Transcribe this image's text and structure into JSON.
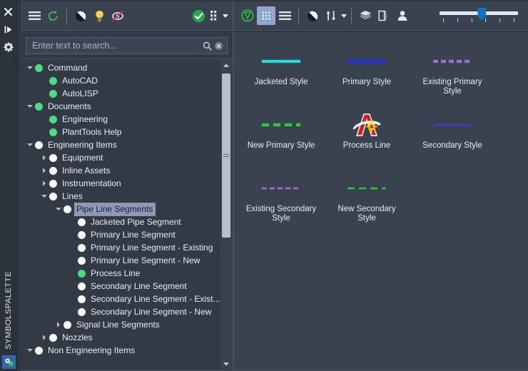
{
  "window": {
    "title": "SYMBOLSPALETTE",
    "rail_icons": [
      "close-icon",
      "dock-pin-icon",
      "settings-gear-icon"
    ],
    "rail_bottom_icon": "plant-tools-icon"
  },
  "left_toolbar": {
    "buttons": [
      {
        "name": "menu-button",
        "icon": "hamburger-menu-icon",
        "active": false
      },
      {
        "name": "refresh-button",
        "icon": "refresh-circular-arrows-icon",
        "active": false
      },
      {
        "name": "contrast-button",
        "icon": "contrast-half-circle-icon",
        "active": false
      },
      {
        "name": "hint-button",
        "icon": "lightbulb-icon",
        "active": false
      },
      {
        "name": "hide-preview-button",
        "icon": "no-preview-crossed-icon",
        "active": false
      },
      {
        "name": "validate-button",
        "icon": "green-check-circle-icon",
        "active": false
      },
      {
        "name": "grid-options-button",
        "icon": "grid-dots-icon",
        "active": false
      }
    ]
  },
  "right_toolbar": {
    "buttons": [
      {
        "name": "shape-filter-button",
        "icon": "green-outline-shape-icon",
        "active": false
      },
      {
        "name": "grid-view-button",
        "icon": "grid-view-icon",
        "active": true
      },
      {
        "name": "list-view-button",
        "icon": "list-view-icon",
        "active": false
      },
      {
        "name": "contrast-button",
        "icon": "contrast-half-circle-icon",
        "active": false
      },
      {
        "name": "sort-button",
        "icon": "sort-arrows-icon",
        "active": false
      },
      {
        "name": "layers-button",
        "icon": "layers-stack-icon",
        "active": false
      },
      {
        "name": "annotation-button",
        "icon": "abc-text-icon",
        "active": false
      },
      {
        "name": "user-button",
        "icon": "person-icon",
        "active": false
      }
    ],
    "zoom_slider": {
      "name": "zoom-slider",
      "tick_count": 6,
      "value_percent": 54
    }
  },
  "search": {
    "placeholder": "Enter text to search...",
    "value": "",
    "search_icon": "magnifier-icon",
    "clear_icon": "clear-circle-x-icon"
  },
  "tree": {
    "items": [
      {
        "label": "Command",
        "indent": 0,
        "twist": "down",
        "dot": "green"
      },
      {
        "label": "AutoCAD",
        "indent": 1,
        "twist": "none",
        "dot": "green"
      },
      {
        "label": "AutoLISP",
        "indent": 1,
        "twist": "none",
        "dot": "green"
      },
      {
        "label": "Documents",
        "indent": 0,
        "twist": "down",
        "dot": "green"
      },
      {
        "label": "Engineering",
        "indent": 1,
        "twist": "none",
        "dot": "green"
      },
      {
        "label": "PlantTools Help",
        "indent": 1,
        "twist": "none",
        "dot": "green"
      },
      {
        "label": "Engineering Items",
        "indent": 0,
        "twist": "down",
        "dot": "white"
      },
      {
        "label": "Equipment",
        "indent": 1,
        "twist": "right",
        "dot": "white"
      },
      {
        "label": "Inline Assets",
        "indent": 1,
        "twist": "right",
        "dot": "white"
      },
      {
        "label": "Instrumentation",
        "indent": 1,
        "twist": "right",
        "dot": "white"
      },
      {
        "label": "Lines",
        "indent": 1,
        "twist": "down",
        "dot": "white"
      },
      {
        "label": "Pipe Line Segments",
        "indent": 2,
        "twist": "down",
        "dot": "white",
        "selected": true
      },
      {
        "label": "Jacketed Pipe Segment",
        "indent": 3,
        "twist": "none",
        "dot": "white"
      },
      {
        "label": "Primary Line Segment",
        "indent": 3,
        "twist": "none",
        "dot": "white"
      },
      {
        "label": "Primary Line Segment - Existing",
        "indent": 3,
        "twist": "none",
        "dot": "white"
      },
      {
        "label": "Primary Line Segment - New",
        "indent": 3,
        "twist": "none",
        "dot": "white"
      },
      {
        "label": "Process Line",
        "indent": 3,
        "twist": "none",
        "dot": "green"
      },
      {
        "label": "Secondary Line Segment",
        "indent": 3,
        "twist": "none",
        "dot": "white"
      },
      {
        "label": "Secondary Line Segment - Exist...",
        "indent": 3,
        "twist": "none",
        "dot": "white"
      },
      {
        "label": "Secondary Line Segment - New",
        "indent": 3,
        "twist": "none",
        "dot": "white"
      },
      {
        "label": "Signal Line Segments",
        "indent": 2,
        "twist": "right",
        "dot": "white"
      },
      {
        "label": "Nozzles",
        "indent": 1,
        "twist": "right",
        "dot": "white"
      },
      {
        "label": "Non Engineering Items",
        "indent": 0,
        "twist": "down",
        "dot": "white"
      }
    ],
    "scrollbar": {
      "name": "tree-vertical-scrollbar"
    }
  },
  "symbols": [
    {
      "label": "Jacketed Style",
      "art": "line",
      "color": "#1ee0d8",
      "dash": "solid"
    },
    {
      "label": "Primary Style",
      "art": "line",
      "color": "#1f30e6",
      "dash": "solid"
    },
    {
      "label": "Existing Primary Style",
      "art": "line",
      "color": "#9b6fd4",
      "dash": "dashed-short"
    },
    {
      "label": "New Primary Style",
      "art": "line",
      "color": "#1fd42b",
      "dash": "dashed-long"
    },
    {
      "label": "Process Line",
      "art": "logo",
      "color": "#d32027",
      "dash": "none"
    },
    {
      "label": "Secondary Style",
      "art": "line",
      "color": "#3b3bdd",
      "dash": "solid",
      "thin": true
    },
    {
      "label": "Existing Secondary Style",
      "art": "line",
      "color": "#9b6fd4",
      "dash": "dashed-short",
      "thin": true
    },
    {
      "label": "New Secondary Style",
      "art": "line",
      "color": "#1fd42b",
      "dash": "dashed-long",
      "thin": true
    }
  ],
  "colors": {
    "window_bg": "#2f3742",
    "panel_bg": "#3a4250",
    "tree_bg": "#323a46",
    "border": "#4a5260",
    "text": "#eaedf1",
    "accent_green": "#4ade80",
    "accent_blue": "#0f74c8",
    "selection": "#8d99bb"
  }
}
